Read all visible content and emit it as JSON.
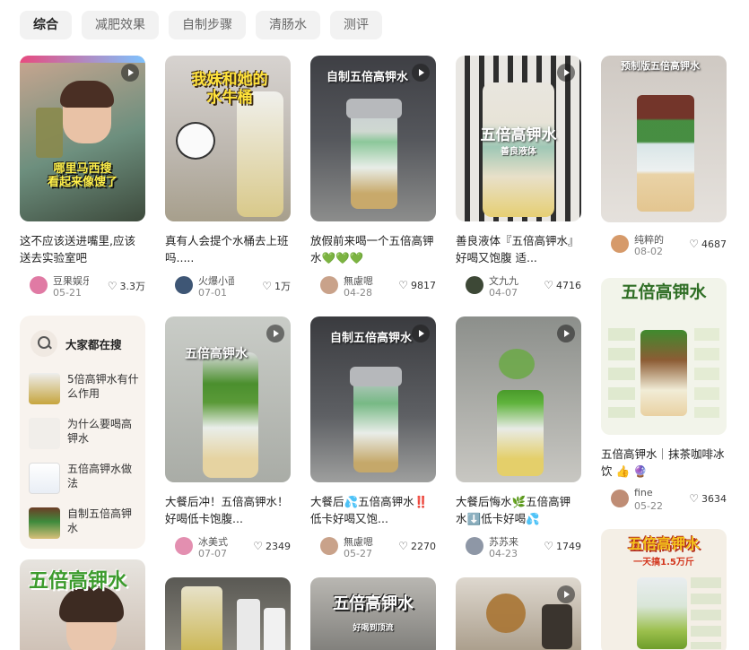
{
  "tabs": [
    {
      "label": "综合",
      "active": true
    },
    {
      "label": "减肥效果"
    },
    {
      "label": "自制步骤"
    },
    {
      "label": "清肠水"
    },
    {
      "label": "测评"
    }
  ],
  "search": {
    "title": "大家都在搜",
    "items": [
      {
        "label": "5倍高钾水有什么作用"
      },
      {
        "label": "为什么要喝高钾水"
      },
      {
        "label": "五倍高钾水做法"
      },
      {
        "label": "自制五倍高钾水"
      }
    ]
  },
  "cards": [
    {
      "title": "这不应该送进嘴里,应该送去实验室吧",
      "author": "豆果娱乐",
      "date": "05-21",
      "likes": "3.3万",
      "overlay": "哪里马西搜\n看起来像馊了"
    },
    {
      "title": "真有人会提个水桶去上班吗.....",
      "author": "火爆小面",
      "date": "07-01",
      "likes": "1万",
      "overlay": "我妹和她的\n水牛桶"
    },
    {
      "title": "放假前来喝一个五倍高钾水💚💚💚",
      "author": "無慮嗯",
      "date": "04-28",
      "likes": "9817",
      "overlay": "自制五倍高钾水"
    },
    {
      "title": "善良液体『五倍高钾水』好喝又饱腹 适...",
      "author": "文九九",
      "date": "04-07",
      "likes": "4716",
      "overlay": "五倍高钾水",
      "sub": "善良液体"
    },
    {
      "title": "",
      "author": "纯粹的",
      "date": "08-02",
      "likes": "4687",
      "overlay": "预制版五倍高钾水"
    },
    {
      "title": "五倍高钾水｜抹茶咖啡冰饮 👍 🔮",
      "author": "fine",
      "date": "05-22",
      "likes": "3634",
      "overlay": "五倍高钾水"
    },
    {
      "title": "大餐后冲！五倍高钾水！好喝低卡饱腹...",
      "author": "冰美式",
      "date": "07-07",
      "likes": "2349",
      "overlay": "五倍高钾水"
    },
    {
      "title": "大餐后💦五倍高钾水‼️低卡好喝又饱...",
      "author": "無慮嗯",
      "date": "05-27",
      "likes": "2270",
      "overlay": "自制五倍高钾水"
    },
    {
      "title": "大餐后悔水🌿五倍高钾水⬇️低卡好喝💦",
      "author": "苏苏来",
      "date": "04-23",
      "likes": "1749",
      "overlay": ""
    },
    {
      "overlay": "五倍高钾水"
    },
    {
      "overlay": ""
    },
    {
      "overlay": "五倍高钾水",
      "sub": "好喝到顶流"
    },
    {
      "overlay": ""
    },
    {
      "overlay": "五倍高钾水",
      "sub": "一天搞1.5万斤"
    }
  ]
}
